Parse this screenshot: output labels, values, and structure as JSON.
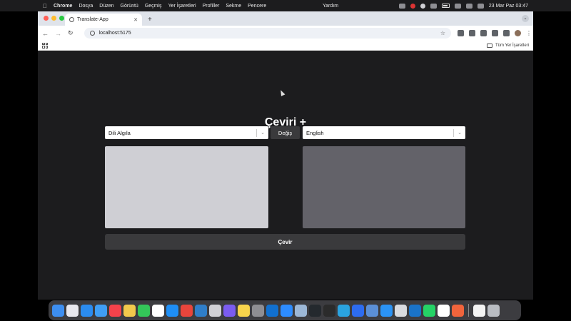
{
  "menubar": {
    "app": "Chrome",
    "items": [
      "Dosya",
      "Düzen",
      "Görüntü",
      "Geçmiş",
      "Yer İşaretleri",
      "Profiller",
      "Sekme",
      "Pencere"
    ],
    "help": "Yardım",
    "clock": "23 Mar Paz  03:47"
  },
  "browser": {
    "tab_title": "Translate-App",
    "url": "localhost:5175",
    "bookmarks_all": "Tüm Yer İşaretleri"
  },
  "app": {
    "title": "Çeviri +",
    "source_language": "Dili Algıla",
    "swap_label": "Değiş",
    "target_language": "English",
    "source_text": "",
    "translated_text": "",
    "translate_label": "Çevir"
  },
  "dock": {
    "icons": [
      {
        "name": "finder-icon",
        "color": "#3d8ef0"
      },
      {
        "name": "launchpad-icon",
        "color": "#e8e8ee"
      },
      {
        "name": "safari-icon",
        "color": "#2b8cf0"
      },
      {
        "name": "mail-icon",
        "color": "#3f9ef5"
      },
      {
        "name": "music-icon",
        "color": "#f5424b"
      },
      {
        "name": "photos-icon",
        "color": "#f2c94c"
      },
      {
        "name": "facetime-icon",
        "color": "#34c759"
      },
      {
        "name": "calendar-icon",
        "color": "#ffffff"
      },
      {
        "name": "app-store-icon",
        "color": "#1e8ef5"
      },
      {
        "name": "chrome-icon",
        "color": "#e8453c"
      },
      {
        "name": "vscode-icon",
        "color": "#2f7ec9"
      },
      {
        "name": "quicktime-icon",
        "color": "#d0d0d6"
      },
      {
        "name": "imovie-icon",
        "color": "#7b5cf0"
      },
      {
        "name": "notes-icon",
        "color": "#f7d44c"
      },
      {
        "name": "system-settings-icon",
        "color": "#8e8e93"
      },
      {
        "name": "outlook-icon",
        "color": "#1170cf"
      },
      {
        "name": "zoom-icon",
        "color": "#2d8cff"
      },
      {
        "name": "preview-icon",
        "color": "#9cb7d6"
      },
      {
        "name": "github-icon",
        "color": "#24292e"
      },
      {
        "name": "terminal-icon",
        "color": "#2b2b2b"
      },
      {
        "name": "telegram-icon",
        "color": "#2aa3e0"
      },
      {
        "name": "zoom-meet-icon",
        "color": "#2d6cf0"
      },
      {
        "name": "screenshot-icon",
        "color": "#5b8fd6"
      },
      {
        "name": "xcode-icon",
        "color": "#2b93f5"
      },
      {
        "name": "font-book-icon",
        "color": "#d9dbe0"
      },
      {
        "name": "visual-studio-icon",
        "color": "#1a73c8"
      },
      {
        "name": "whatsapp-icon",
        "color": "#25d366"
      },
      {
        "name": "slack-icon",
        "color": "#ffffff"
      },
      {
        "name": "swift-icon",
        "color": "#f0643c"
      }
    ],
    "tail_icons": [
      {
        "name": "textedit-icon",
        "color": "#f3f3f3"
      },
      {
        "name": "trash-icon",
        "color": "#b9bcc2"
      }
    ]
  }
}
